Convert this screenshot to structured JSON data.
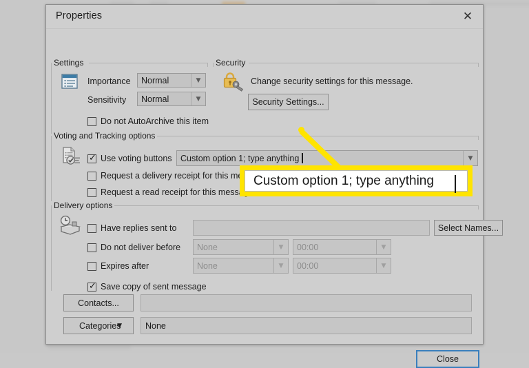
{
  "window": {
    "title": "Properties",
    "close_icon": "close-icon"
  },
  "settings": {
    "group_label": "Settings",
    "icon": "properties-list-icon",
    "importance": {
      "label": "Importance",
      "value": "Normal"
    },
    "sensitivity": {
      "label": "Sensitivity",
      "value": "Normal"
    },
    "autoarchive": {
      "label": "Do not AutoArchive this item",
      "checked": false
    }
  },
  "security": {
    "group_label": "Security",
    "icon": "lock-key-icon",
    "description": "Change security settings for this message.",
    "button_label": "Security Settings..."
  },
  "voting": {
    "group_label": "Voting and Tracking options",
    "icon": "voting-document-icon",
    "use_voting_buttons": {
      "label": "Use voting buttons",
      "checked": true
    },
    "voting_value": "Custom option 1; type anything",
    "delivery_receipt": {
      "label": "Request a delivery receipt for this message",
      "checked": false
    },
    "read_receipt": {
      "label": "Request a read receipt for this message",
      "checked": false
    }
  },
  "delivery": {
    "group_label": "Delivery options",
    "icon": "clock-envelope-icon",
    "have_replies_sent_to": {
      "label": "Have replies sent to",
      "checked": false,
      "value": ""
    },
    "select_names_button": "Select Names...",
    "do_not_deliver_before": {
      "label": "Do not deliver before",
      "checked": false,
      "date": "None",
      "time": "00:00"
    },
    "expires_after": {
      "label": "Expires after",
      "checked": false,
      "date": "None",
      "time": "00:00"
    },
    "save_copy": {
      "label": "Save copy of sent message",
      "checked": true
    }
  },
  "bottom": {
    "contacts_button": "Contacts...",
    "contacts_value": "",
    "categories_button": "Categories",
    "categories_value": "None"
  },
  "footer": {
    "close_button": "Close"
  },
  "annotation": {
    "callout_text": "Custom option 1; type anything",
    "accent_color": "#ffe400"
  }
}
